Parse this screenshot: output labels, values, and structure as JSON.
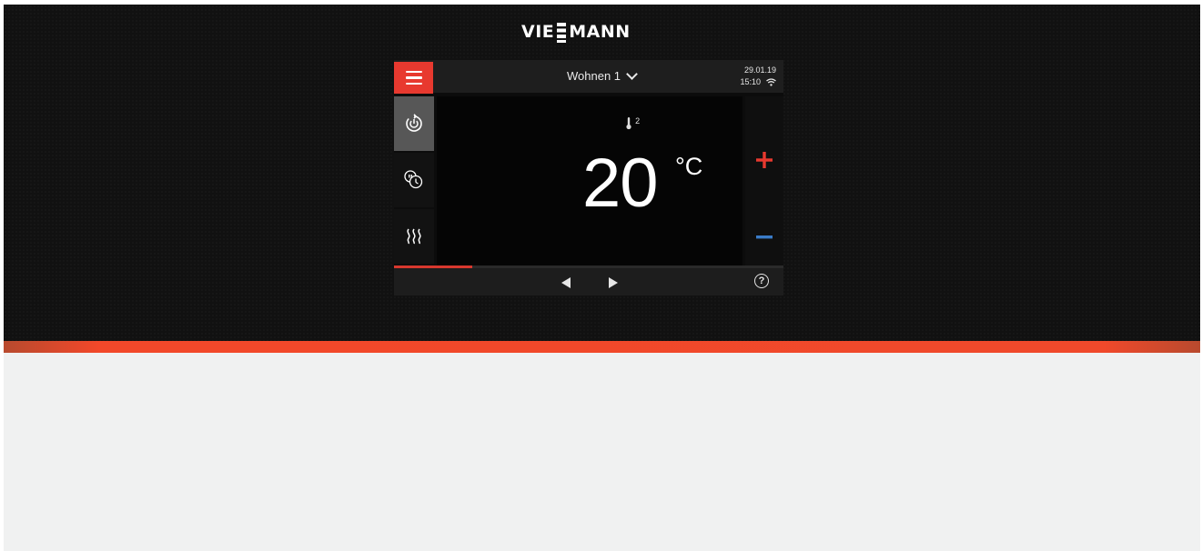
{
  "brand": {
    "logo_text_left": "VIE",
    "logo_text_right": "MANN"
  },
  "header": {
    "zone_label": "Wohnen 1",
    "date": "29.01.19",
    "time": "15:10"
  },
  "sidebar": {
    "items": [
      {
        "icon": "standby-power-icon",
        "active": true
      },
      {
        "icon": "schedule-clock-icon",
        "active": false
      },
      {
        "icon": "heating-icon",
        "active": false
      }
    ]
  },
  "main": {
    "heating_circuit": "2",
    "temperature_value": "20",
    "temperature_unit": "°C"
  },
  "progress": {
    "value": 0.2
  },
  "footer": {
    "help_label": "?"
  },
  "colors": {
    "accent_red": "#e8392f",
    "plus_red": "#e8392f",
    "minus_blue": "#3a7bc8",
    "strip_orange": "#f0492b"
  }
}
